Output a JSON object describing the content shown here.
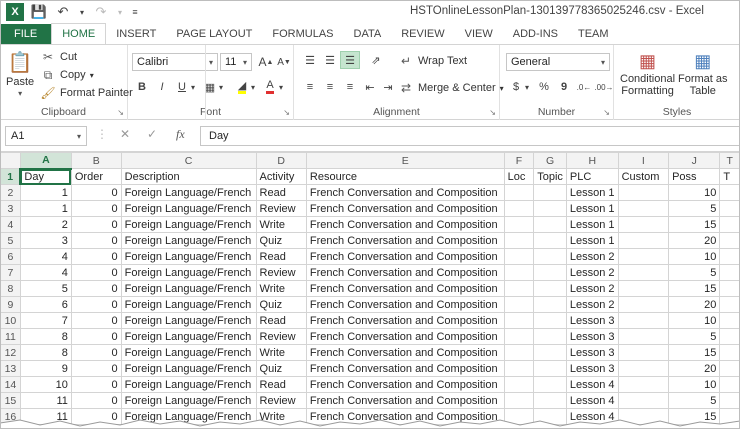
{
  "window": {
    "title": "HSTOnlineLessonPlan-130139778365025246.csv - Excel"
  },
  "tabs": [
    "FILE",
    "HOME",
    "INSERT",
    "PAGE LAYOUT",
    "FORMULAS",
    "DATA",
    "REVIEW",
    "VIEW",
    "ADD-INS",
    "TEAM"
  ],
  "ribbon": {
    "clipboard": {
      "paste": "Paste",
      "cut": "Cut",
      "copy": "Copy",
      "format_painter": "Format Painter",
      "label": "Clipboard"
    },
    "font": {
      "family": "Calibri",
      "size": "11",
      "label": "Font",
      "bold": "B",
      "italic": "I",
      "underline": "U"
    },
    "alignment": {
      "wrap_text": "Wrap Text",
      "merge_center": "Merge & Center",
      "label": "Alignment"
    },
    "number": {
      "format": "General",
      "currency": "$",
      "percent": "%",
      "comma": "9",
      "label": "Number"
    },
    "styles": {
      "conditional_formatting": "Conditional",
      "conditional_formatting_2": "Formatting",
      "format_as_table": "Format as",
      "format_as_table_2": "Table",
      "label": "Styles"
    }
  },
  "formula_bar": {
    "name_box": "A1",
    "fx": "fx",
    "value": "Day"
  },
  "sheet": {
    "columns": [
      "A",
      "B",
      "C",
      "D",
      "E",
      "F",
      "G",
      "H",
      "I",
      "J",
      "T"
    ],
    "header_row": [
      "Day",
      "Order",
      "Description",
      "Activity",
      "Resource",
      "Loc",
      "Topic",
      "PLC",
      "Custom",
      "Poss",
      "T"
    ],
    "rows": [
      {
        "n": "2",
        "cells": [
          "1",
          "0",
          "Foreign Language/French",
          "Read",
          "French Conversation and Composition",
          "",
          "",
          "Lesson  1",
          "",
          "10"
        ]
      },
      {
        "n": "3",
        "cells": [
          "1",
          "0",
          "Foreign Language/French",
          "Review",
          "French Conversation and Composition",
          "",
          "",
          "Lesson  1",
          "",
          "5"
        ]
      },
      {
        "n": "4",
        "cells": [
          "2",
          "0",
          "Foreign Language/French",
          "Write",
          "French Conversation and Composition",
          "",
          "",
          "Lesson 1",
          "",
          "15"
        ]
      },
      {
        "n": "5",
        "cells": [
          "3",
          "0",
          "Foreign Language/French",
          "Quiz",
          "French Conversation and Composition",
          "",
          "",
          "Lesson 1",
          "",
          "20"
        ]
      },
      {
        "n": "6",
        "cells": [
          "4",
          "0",
          "Foreign Language/French",
          "Read",
          "French Conversation and Composition",
          "",
          "",
          "Lesson  2",
          "",
          "10"
        ]
      },
      {
        "n": "7",
        "cells": [
          "4",
          "0",
          "Foreign Language/French",
          "Review",
          "French Conversation and Composition",
          "",
          "",
          "Lesson  2",
          "",
          "5"
        ]
      },
      {
        "n": "8",
        "cells": [
          "5",
          "0",
          "Foreign Language/French",
          "Write",
          "French Conversation and Composition",
          "",
          "",
          "Lesson 2",
          "",
          "15"
        ]
      },
      {
        "n": "9",
        "cells": [
          "6",
          "0",
          "Foreign Language/French",
          "Quiz",
          "French Conversation and Composition",
          "",
          "",
          "Lesson 2",
          "",
          "20"
        ]
      },
      {
        "n": "10",
        "cells": [
          "7",
          "0",
          "Foreign Language/French",
          "Read",
          "French Conversation and Composition",
          "",
          "",
          "Lesson  3",
          "",
          "10"
        ]
      },
      {
        "n": "11",
        "cells": [
          "8",
          "0",
          "Foreign Language/French",
          "Review",
          "French Conversation and Composition",
          "",
          "",
          "Lesson 3",
          "",
          "5"
        ]
      },
      {
        "n": "12",
        "cells": [
          "8",
          "0",
          "Foreign Language/French",
          "Write",
          "French Conversation and Composition",
          "",
          "",
          "Lesson 3",
          "",
          "15"
        ]
      },
      {
        "n": "13",
        "cells": [
          "9",
          "0",
          "Foreign Language/French",
          "Quiz",
          "French Conversation and Composition",
          "",
          "",
          "Lesson 3",
          "",
          "20"
        ]
      },
      {
        "n": "14",
        "cells": [
          "10",
          "0",
          "Foreign Language/French",
          "Read",
          "French Conversation and Composition",
          "",
          "",
          "Lesson  4",
          "",
          "10"
        ]
      },
      {
        "n": "15",
        "cells": [
          "11",
          "0",
          "Foreign Language/French",
          "Review",
          "French Conversation and Composition",
          "",
          "",
          "Lesson  4",
          "",
          "5"
        ]
      },
      {
        "n": "16",
        "cells": [
          "11",
          "0",
          "Foreign Language/French",
          "Write",
          "French Conversation and Composition",
          "",
          "",
          "Lesson 4",
          "",
          "15"
        ]
      }
    ]
  },
  "colors": {
    "accent": "#217346",
    "selection_header": "#d2e4d8",
    "grid_line": "#d4d4d4"
  }
}
